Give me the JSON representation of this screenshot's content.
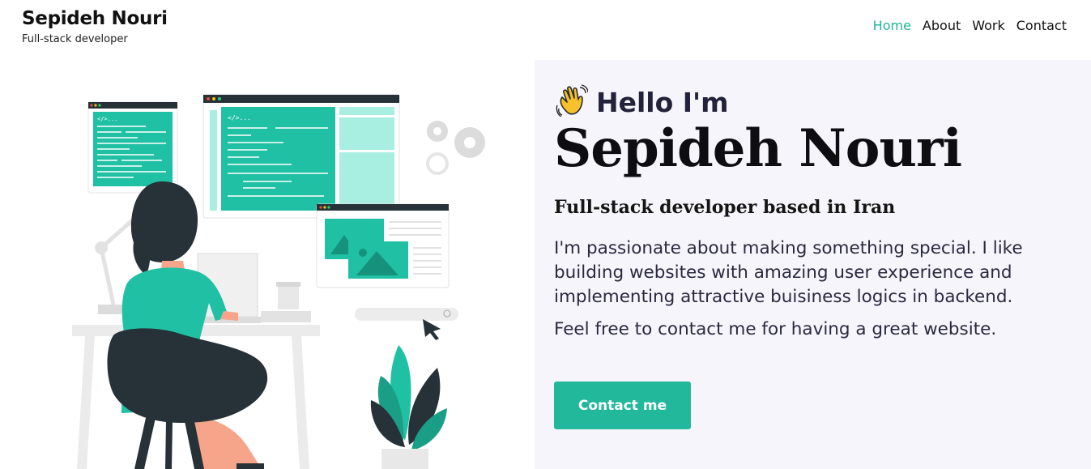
{
  "header": {
    "brand_name": "Sepideh Nouri",
    "brand_subtitle": "Full-stack developer",
    "nav": [
      {
        "label": "Home",
        "active": true
      },
      {
        "label": "About",
        "active": false
      },
      {
        "label": "Work",
        "active": false
      },
      {
        "label": "Contact",
        "active": false
      }
    ]
  },
  "hero": {
    "greeting_icon": "waving-hand-icon",
    "greeting": "Hello I'm",
    "name": "Sepideh Nouri",
    "tagline": "Full-stack developer based in Iran",
    "description": "I'm passionate about making something special. I like building websites with amazing user experience and implementing attractive buisiness logics in backend.",
    "cta_text": "Feel free to contact me for having a great website.",
    "contact_button": "Contact me"
  },
  "illustration": {
    "code_label": "</>..."
  },
  "colors": {
    "accent": "#20b49a",
    "hero_bg": "#f6f5fb",
    "dark": "#263238"
  }
}
